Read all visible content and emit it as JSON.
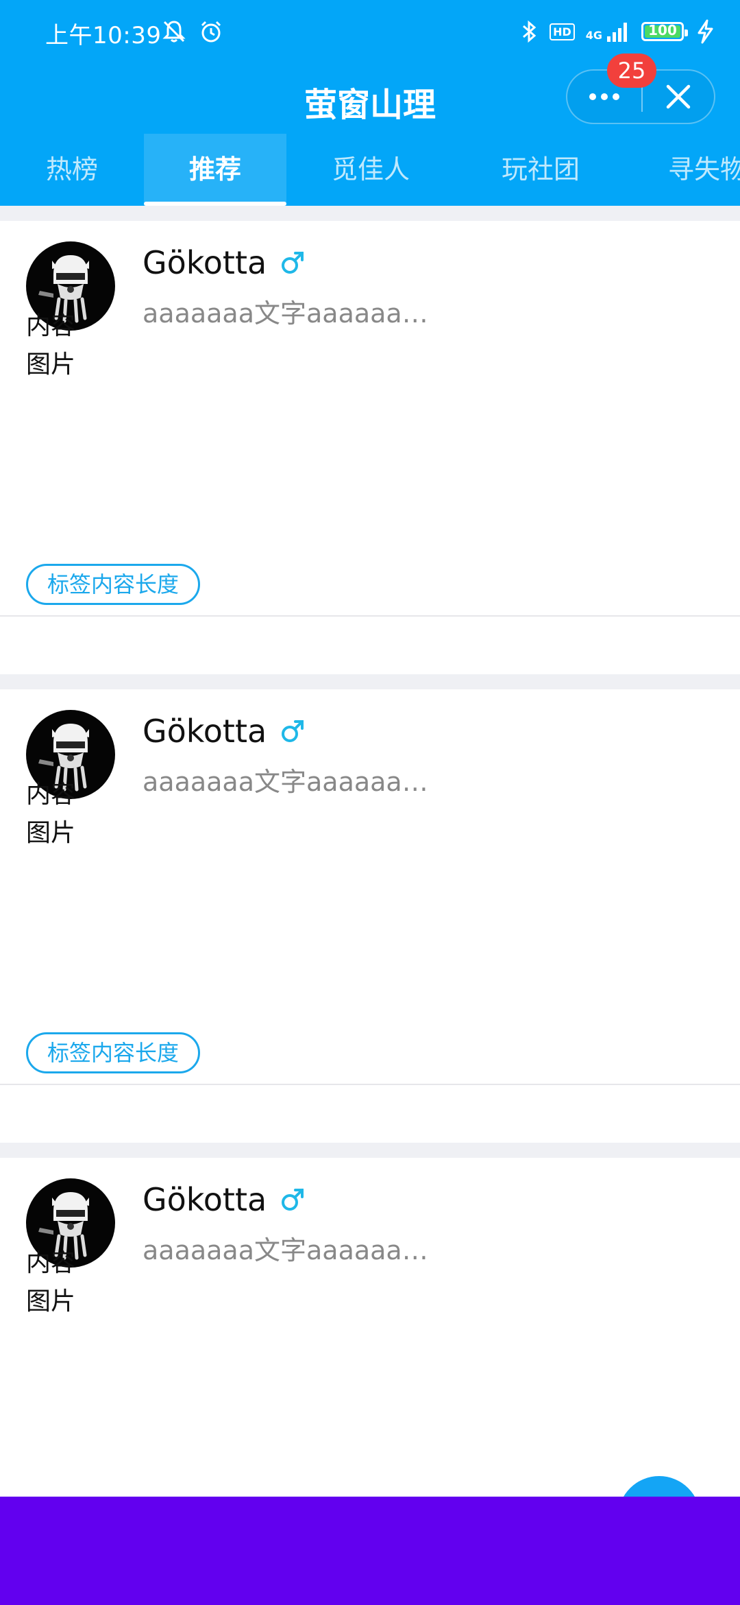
{
  "status_bar": {
    "time": "上午10:39",
    "hd": "HD",
    "network": "4G",
    "battery": "100"
  },
  "nav": {
    "title": "萤窗山理",
    "badge_count": "25"
  },
  "tabs": [
    {
      "label": "热榜",
      "active": false
    },
    {
      "label": "推荐",
      "active": true
    },
    {
      "label": "觅佳人",
      "active": false
    },
    {
      "label": "玩社团",
      "active": false
    },
    {
      "label": "寻失物",
      "active": false
    }
  ],
  "posts": [
    {
      "username": "Gökotta",
      "gender": "male",
      "subtitle": "aaaaaaa文字aaaaaa…",
      "content_line1": "内容",
      "content_line2": "图片",
      "tag": "标签内容长度"
    },
    {
      "username": "Gökotta",
      "gender": "male",
      "subtitle": "aaaaaaa文字aaaaaa…",
      "content_line1": "内容",
      "content_line2": "图片",
      "tag": "标签内容长度"
    },
    {
      "username": "Gökotta",
      "gender": "male",
      "subtitle": "aaaaaaa文字aaaaaa…",
      "content_line1": "内容",
      "content_line2": "图片"
    }
  ],
  "colors": {
    "header": "#03a6f8",
    "tag": "#1ba8ec",
    "gender": "#1fb8e8",
    "badge": "#f2403c",
    "bottom_bar": "#6200ef"
  }
}
